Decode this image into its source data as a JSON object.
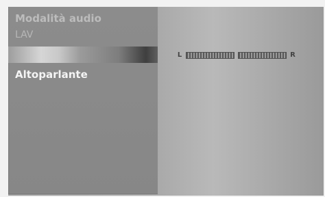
{
  "menu": {
    "title": "Modalità audio",
    "subtitle": "LAV",
    "options": [
      "Altoparlante"
    ]
  },
  "meter": {
    "left_label": "L",
    "right_label": "R"
  },
  "colors": {
    "screen_bg": "#a7a7a7",
    "panel_bg": "#8c8c8c",
    "selected_text": "#f4f4f4"
  }
}
